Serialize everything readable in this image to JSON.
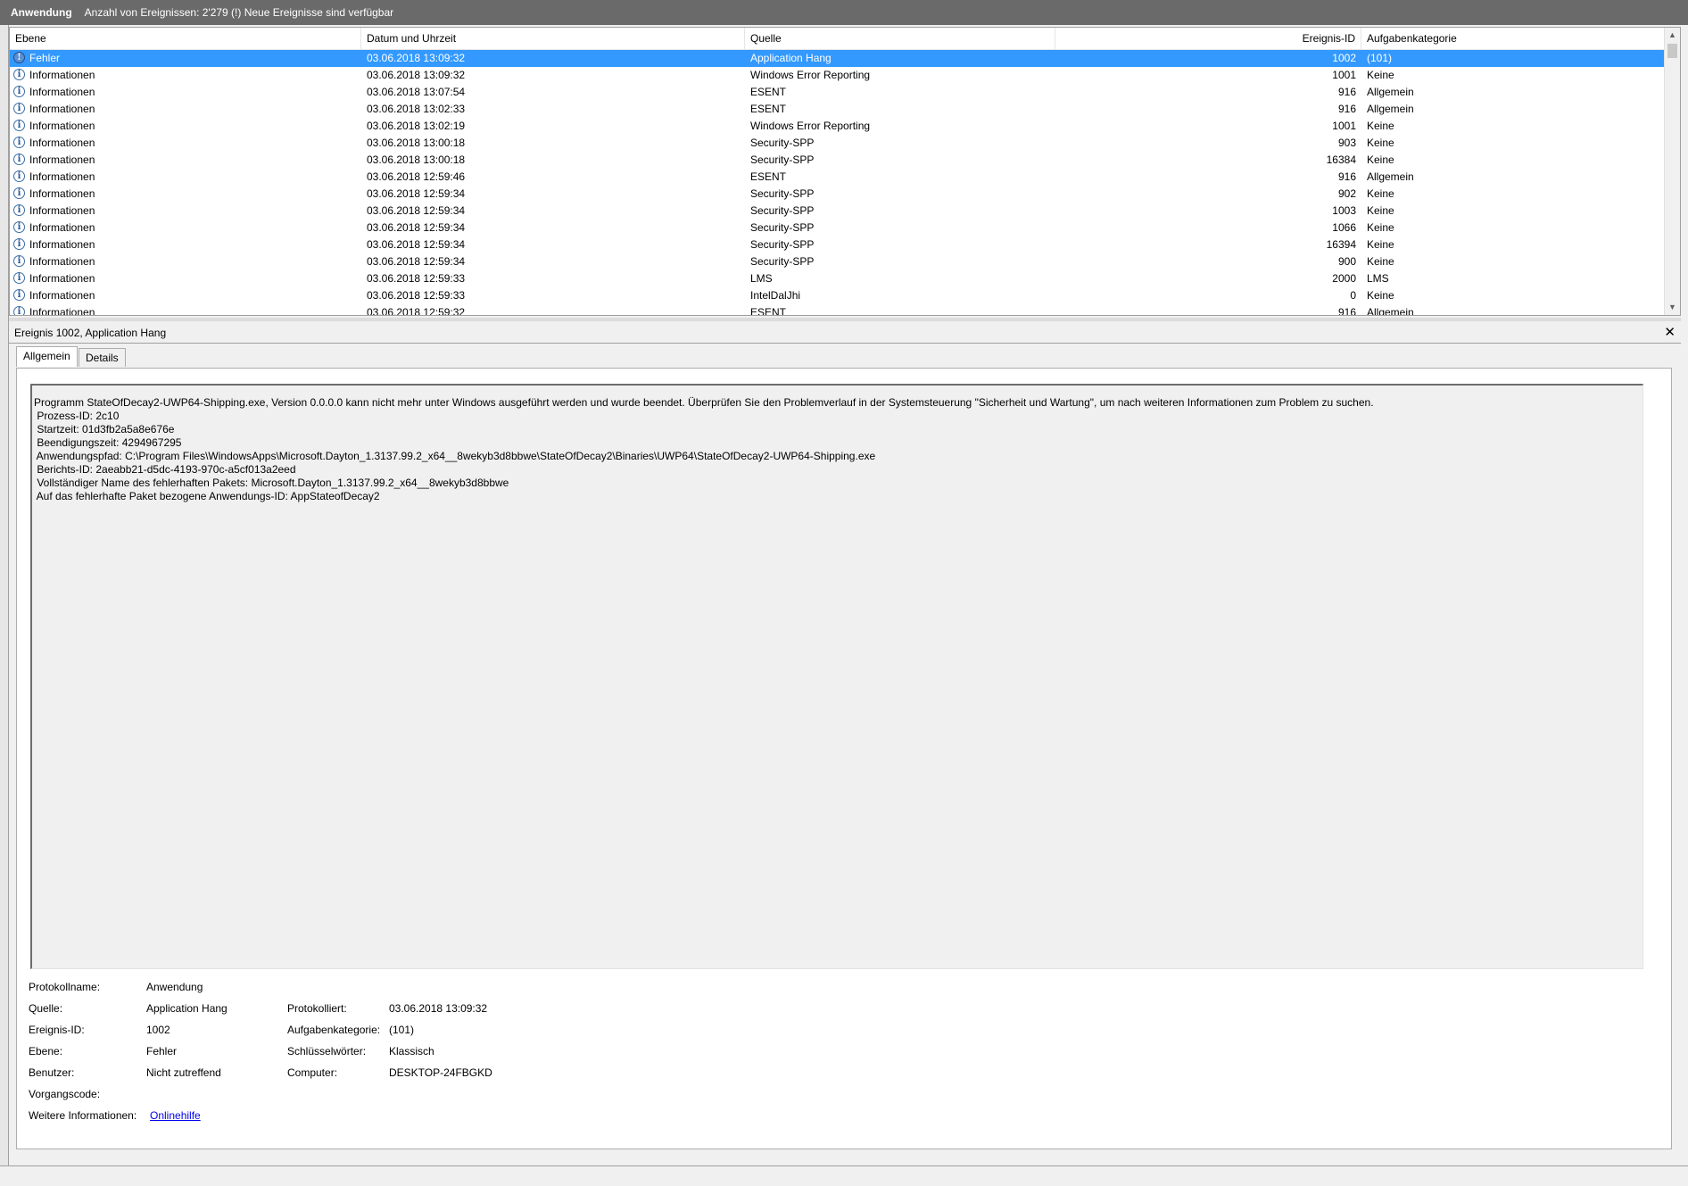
{
  "header": {
    "log_name": "Anwendung",
    "summary": "Anzahl von Ereignissen: 2'279 (!) Neue Ereignisse sind verfügbar"
  },
  "grid": {
    "columns": [
      "Ebene",
      "Datum und Uhrzeit",
      "Quelle",
      "Ereignis-ID",
      "Aufgabenkategorie"
    ],
    "rows": [
      {
        "level": "Fehler",
        "date": "03.06.2018 13:09:32",
        "source": "Application Hang",
        "id": "1002",
        "category": "(101)"
      },
      {
        "level": "Informationen",
        "date": "03.06.2018 13:09:32",
        "source": "Windows Error Reporting",
        "id": "1001",
        "category": "Keine"
      },
      {
        "level": "Informationen",
        "date": "03.06.2018 13:07:54",
        "source": "ESENT",
        "id": "916",
        "category": "Allgemein"
      },
      {
        "level": "Informationen",
        "date": "03.06.2018 13:02:33",
        "source": "ESENT",
        "id": "916",
        "category": "Allgemein"
      },
      {
        "level": "Informationen",
        "date": "03.06.2018 13:02:19",
        "source": "Windows Error Reporting",
        "id": "1001",
        "category": "Keine"
      },
      {
        "level": "Informationen",
        "date": "03.06.2018 13:00:18",
        "source": "Security-SPP",
        "id": "903",
        "category": "Keine"
      },
      {
        "level": "Informationen",
        "date": "03.06.2018 13:00:18",
        "source": "Security-SPP",
        "id": "16384",
        "category": "Keine"
      },
      {
        "level": "Informationen",
        "date": "03.06.2018 12:59:46",
        "source": "ESENT",
        "id": "916",
        "category": "Allgemein"
      },
      {
        "level": "Informationen",
        "date": "03.06.2018 12:59:34",
        "source": "Security-SPP",
        "id": "902",
        "category": "Keine"
      },
      {
        "level": "Informationen",
        "date": "03.06.2018 12:59:34",
        "source": "Security-SPP",
        "id": "1003",
        "category": "Keine"
      },
      {
        "level": "Informationen",
        "date": "03.06.2018 12:59:34",
        "source": "Security-SPP",
        "id": "1066",
        "category": "Keine"
      },
      {
        "level": "Informationen",
        "date": "03.06.2018 12:59:34",
        "source": "Security-SPP",
        "id": "16394",
        "category": "Keine"
      },
      {
        "level": "Informationen",
        "date": "03.06.2018 12:59:34",
        "source": "Security-SPP",
        "id": "900",
        "category": "Keine"
      },
      {
        "level": "Informationen",
        "date": "03.06.2018 12:59:33",
        "source": "LMS",
        "id": "2000",
        "category": "LMS"
      },
      {
        "level": "Informationen",
        "date": "03.06.2018 12:59:33",
        "source": "IntelDalJhi",
        "id": "0",
        "category": "Keine"
      },
      {
        "level": "Informationen",
        "date": "03.06.2018 12:59:32",
        "source": "ESENT",
        "id": "916",
        "category": "Allgemein"
      }
    ]
  },
  "detail": {
    "title": "Ereignis 1002, Application Hang",
    "close_icon": "close-icon",
    "tabs": [
      "Allgemein",
      "Details"
    ],
    "message_lines": [
      "Programm StateOfDecay2-UWP64-Shipping.exe, Version 0.0.0.0 kann nicht mehr unter Windows ausgeführt werden und wurde beendet. Überprüfen Sie den Problemverlauf in der Systemsteuerung \"Sicherheit und Wartung\", um nach weiteren Informationen zum Problem zu suchen.",
      " Prozess-ID: 2c10",
      " Startzeit: 01d3fb2a5a8e676e",
      " Beendigungszeit: 4294967295",
      " Anwendungspfad: C:\\Program Files\\WindowsApps\\Microsoft.Dayton_1.3137.99.2_x64__8wekyb3d8bbwe\\StateOfDecay2\\Binaries\\UWP64\\StateOfDecay2-UWP64-Shipping.exe",
      " Berichts-ID: 2aeabb21-d5dc-4193-970c-a5cf013a2eed",
      " Vollständiger Name des fehlerhaften Pakets: Microsoft.Dayton_1.3137.99.2_x64__8wekyb3d8bbwe",
      " Auf das fehlerhafte Paket bezogene Anwendungs-ID: AppStateofDecay2"
    ],
    "props": {
      "protokollname_label": "Protokollname:",
      "protokollname": "Anwendung",
      "quelle_label": "Quelle:",
      "quelle": "Application Hang",
      "protokolliert_label": "Protokolliert:",
      "protokolliert": "03.06.2018 13:09:32",
      "ereignis_id_label": "Ereignis-ID:",
      "ereignis_id": "1002",
      "aufgabenkategorie_label": "Aufgabenkategorie:",
      "aufgabenkategorie": "(101)",
      "ebene_label": "Ebene:",
      "ebene": "Fehler",
      "schluesselwoerter_label": "Schlüsselwörter:",
      "schluesselwoerter": "Klassisch",
      "benutzer_label": "Benutzer:",
      "benutzer": "Nicht zutreffend",
      "computer_label": "Computer:",
      "computer": "DESKTOP-24FBGKD",
      "vorgangscode_label": "Vorgangscode:",
      "vorgangscode": "",
      "weitere_label": "Weitere Informationen:",
      "onlinehilfe": "Onlinehilfe"
    }
  },
  "colors": {
    "selection": "#3399ff",
    "titlebar": "#6a6a6a",
    "link": "#0000ee"
  },
  "icons": {
    "info": "information-icon",
    "error": "error-icon"
  }
}
